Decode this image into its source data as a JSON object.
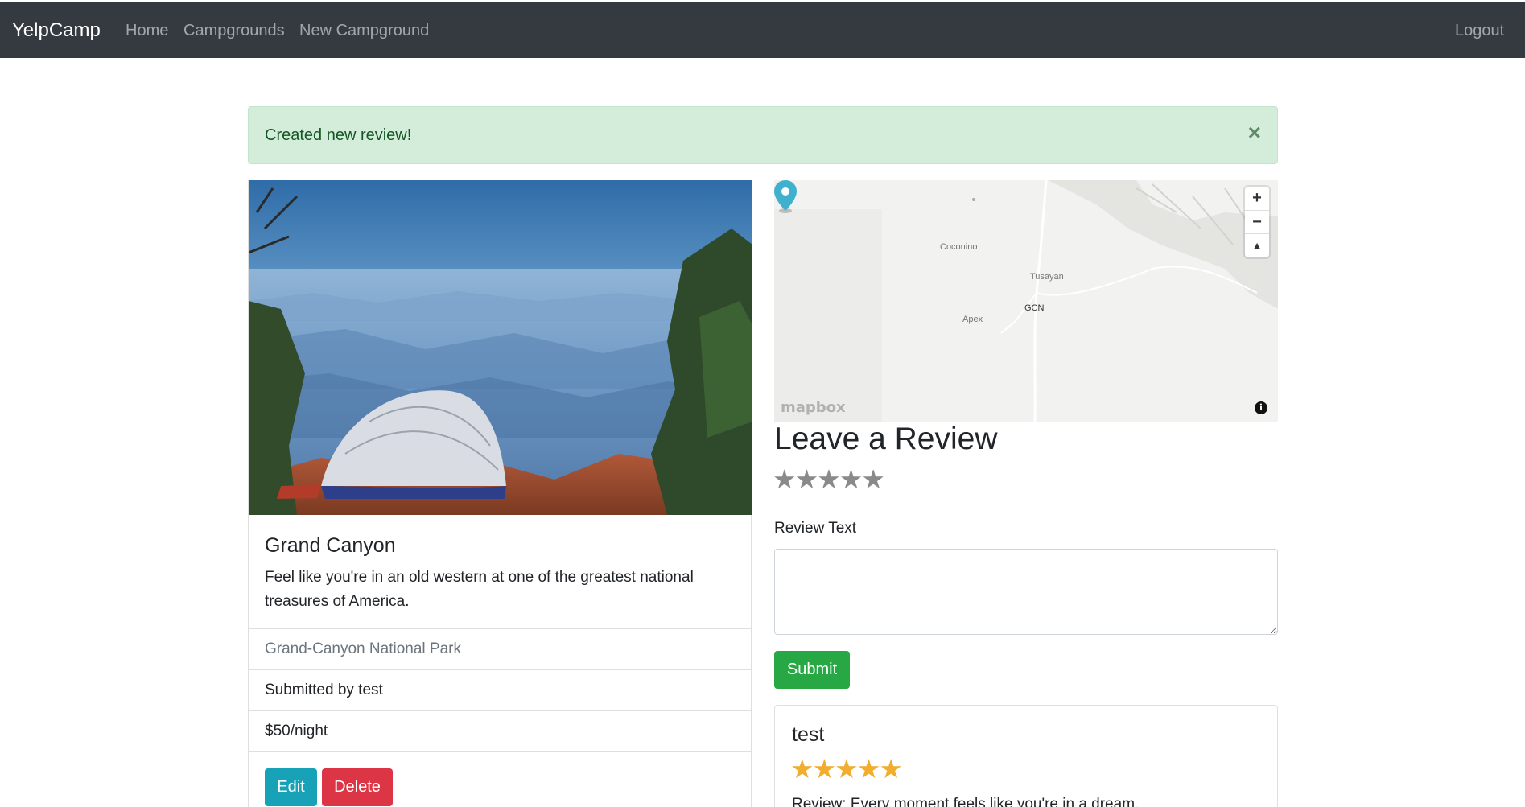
{
  "navbar": {
    "brand": "YelpCamp",
    "links": [
      "Home",
      "Campgrounds",
      "New Campground"
    ],
    "logout": "Logout",
    "bg_color": "#343a40"
  },
  "alert": {
    "message": "Created new review!",
    "close_icon": "close-icon",
    "close_glyph": "×",
    "bg_color": "#d4edda"
  },
  "campground": {
    "title": "Grand Canyon",
    "description": "Feel like you're in an old western at one of the greatest national treasures of America.",
    "location": "Grand-Canyon National Park",
    "submitted_by": "Submitted by test",
    "price": "$50/night",
    "edit_label": "Edit",
    "delete_label": "Delete",
    "image_subject": "tent-on-canyon-rim"
  },
  "map": {
    "labels": {
      "coconino": "Coconino",
      "tusayan": "Tusayan",
      "apex": "Apex",
      "gcn": "GCN"
    },
    "zoom_in": "+",
    "zoom_out": "−",
    "compass": "▲",
    "attribution": "mapbox",
    "info": "i",
    "marker_color": "#3fb1ce"
  },
  "review_form": {
    "heading": "Leave a Review",
    "rating_stars": "★★★★★",
    "rating_value": 0,
    "text_label": "Review Text",
    "text_value": "",
    "submit_label": "Submit"
  },
  "reviews": [
    {
      "author": "test",
      "rating": 5,
      "stars": "★★★★★",
      "body": "Review: Every moment feels like you're in a dream."
    }
  ],
  "colors": {
    "edit": "#17a2b8",
    "delete": "#dc3545",
    "submit": "#28a745",
    "star_filled": "#f0ad2e",
    "star_empty": "#8a8a8a"
  }
}
